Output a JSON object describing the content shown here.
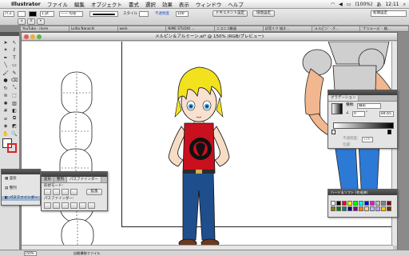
{
  "menubar": {
    "app": "Illustrator",
    "items": [
      "ファイル",
      "編集",
      "オブジェクト",
      "書式",
      "選択",
      "効果",
      "表示",
      "ウィンドウ",
      "ヘルプ"
    ],
    "battery": "(100%)",
    "input_mode": "あ",
    "clock": "12:11"
  },
  "controlbar": {
    "style_label": "スタイル",
    "opacity_label": "不透明度",
    "opacity_value": "100",
    "doc_setup": "ドキュメント設定",
    "prefs": "環境設定",
    "workspace": "初期設定"
  },
  "browser_tabs": [
    "YouTube - more",
    "Lolita Nanachi",
    "work",
    "NIME STUDIO ...",
    "ニコニコ動画",
    "初音ミク 描き...",
    "'メルピン' - グ...",
    "'ナツメール' - 検..."
  ],
  "document": {
    "title": "メルピン＆アルミーン.ai* @ 150% (RGB/プレビュー)",
    "zoom": "150%",
    "status": "自動遷移ファイル"
  },
  "pathfinder_panel": {
    "tabs": [
      "変形",
      "整列",
      "パスファインダー"
    ],
    "shape_modes_label": "形状モード:",
    "expand_button": "拡張",
    "pathfinder_label": "パスファインダー:"
  },
  "small_panel": {
    "items": [
      "変形",
      "整列",
      "パスファインダー"
    ]
  },
  "gradient_panel": {
    "tab": "グラデーション",
    "type_label": "種類:",
    "type_value": "線形",
    "angle_value": "0",
    "angle_unit": "°",
    "location_label": "位置:",
    "location_value": "84.65",
    "opacity_label": "不透明度:",
    "opacity_value": "100"
  },
  "swatch_panel": {
    "tab": "ハード＆ソフト (作成済)",
    "colors": [
      "#ffffff",
      "#000000",
      "#ff0000",
      "#ffff00",
      "#00ff00",
      "#00ffff",
      "#0000ff",
      "#ff00ff",
      "#c0c0c0",
      "#808080",
      "#800000",
      "#808000",
      "#008000",
      "#008080",
      "#000080",
      "#800080",
      "#ff8000",
      "#ffcc99",
      "#99ccff",
      "#cc99ff",
      "#ffcc00",
      "#663300"
    ]
  },
  "tools": [
    {
      "name": "selection-tool",
      "glyph": "➤"
    },
    {
      "name": "direct-selection-tool",
      "glyph": "↖"
    },
    {
      "name": "magic-wand-tool",
      "glyph": "✶"
    },
    {
      "name": "lasso-tool",
      "glyph": "ℓ"
    },
    {
      "name": "pen-tool",
      "glyph": "✒"
    },
    {
      "name": "type-tool",
      "glyph": "T"
    },
    {
      "name": "line-tool",
      "glyph": "╲"
    },
    {
      "name": "rectangle-tool",
      "glyph": "▭"
    },
    {
      "name": "paintbrush-tool",
      "glyph": "🖌"
    },
    {
      "name": "pencil-tool",
      "glyph": "✎"
    },
    {
      "name": "blob-brush-tool",
      "glyph": "●"
    },
    {
      "name": "eraser-tool",
      "glyph": "⌫"
    },
    {
      "name": "rotate-tool",
      "glyph": "↻"
    },
    {
      "name": "scale-tool",
      "glyph": "⤡"
    },
    {
      "name": "warp-tool",
      "glyph": "≋"
    },
    {
      "name": "free-transform-tool",
      "glyph": "⬚"
    },
    {
      "name": "symbol-sprayer-tool",
      "glyph": "✺"
    },
    {
      "name": "graph-tool",
      "glyph": "▥"
    },
    {
      "name": "mesh-tool",
      "glyph": "#"
    },
    {
      "name": "gradient-tool",
      "glyph": "◧"
    },
    {
      "name": "eyedropper-tool",
      "glyph": "⌀"
    },
    {
      "name": "blend-tool",
      "glyph": "⧉"
    },
    {
      "name": "live-paint-tool",
      "glyph": "◈"
    },
    {
      "name": "slice-tool",
      "glyph": "◩"
    },
    {
      "name": "hand-tool",
      "glyph": "✋"
    },
    {
      "name": "zoom-tool",
      "glyph": "🔍"
    }
  ]
}
